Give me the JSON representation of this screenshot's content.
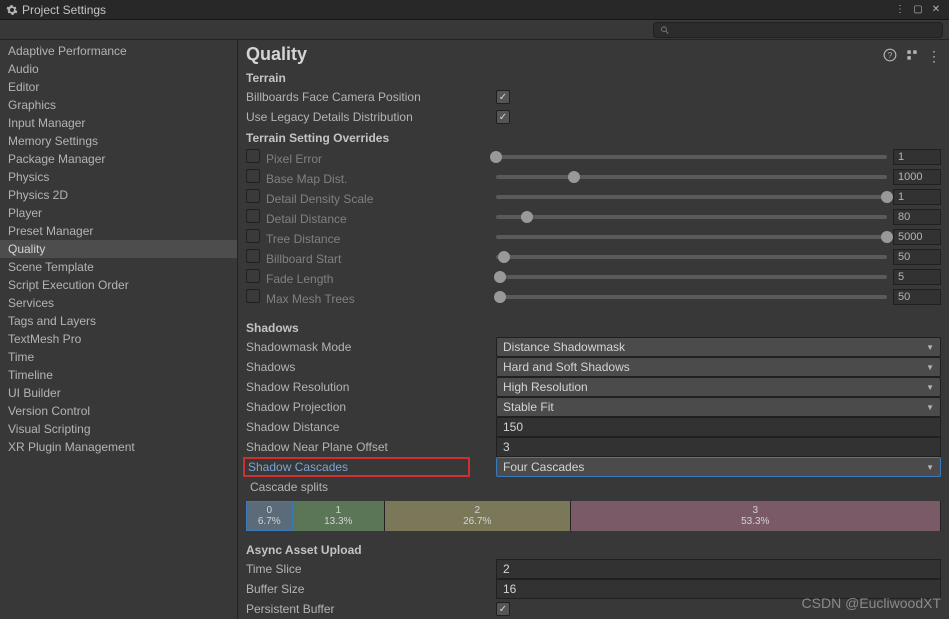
{
  "window": {
    "title": "Project Settings"
  },
  "search": {
    "placeholder": ""
  },
  "sidebar": {
    "items": [
      "Adaptive Performance",
      "Audio",
      "Editor",
      "Graphics",
      "Input Manager",
      "Memory Settings",
      "Package Manager",
      "Physics",
      "Physics 2D",
      "Player",
      "Preset Manager",
      "Quality",
      "Scene Template",
      "Script Execution Order",
      "Services",
      "Tags and Layers",
      "TextMesh Pro",
      "Time",
      "Timeline",
      "UI Builder",
      "Version Control",
      "Visual Scripting",
      "XR Plugin Management"
    ],
    "selected": 11
  },
  "page": {
    "title": "Quality"
  },
  "terrain": {
    "heading": "Terrain",
    "billboards_label": "Billboards Face Camera Position",
    "billboards_checked": true,
    "legacy_label": "Use Legacy Details Distribution",
    "legacy_checked": true
  },
  "overrides": {
    "heading": "Terrain Setting Overrides",
    "rows": [
      {
        "label": "Pixel Error",
        "value": "1",
        "pos": 0
      },
      {
        "label": "Base Map Dist.",
        "value": "1000",
        "pos": 20
      },
      {
        "label": "Detail Density Scale",
        "value": "1",
        "pos": 100
      },
      {
        "label": "Detail Distance",
        "value": "80",
        "pos": 8
      },
      {
        "label": "Tree Distance",
        "value": "5000",
        "pos": 100
      },
      {
        "label": "Billboard Start",
        "value": "50",
        "pos": 2
      },
      {
        "label": "Fade Length",
        "value": "5",
        "pos": 1
      },
      {
        "label": "Max Mesh Trees",
        "value": "50",
        "pos": 1
      }
    ]
  },
  "shadows": {
    "heading": "Shadows",
    "mask_label": "Shadowmask Mode",
    "mask_value": "Distance Shadowmask",
    "shadows_label": "Shadows",
    "shadows_value": "Hard and Soft Shadows",
    "res_label": "Shadow Resolution",
    "res_value": "High Resolution",
    "proj_label": "Shadow Projection",
    "proj_value": "Stable Fit",
    "dist_label": "Shadow Distance",
    "dist_value": "150",
    "near_label": "Shadow Near Plane Offset",
    "near_value": "3",
    "casc_label": "Shadow Cascades",
    "casc_value": "Four Cascades",
    "splits_label": "Cascade splits",
    "cascade": [
      {
        "idx": "0",
        "pct": "6.7%",
        "w": 6.7
      },
      {
        "idx": "1",
        "pct": "13.3%",
        "w": 13.3
      },
      {
        "idx": "2",
        "pct": "26.7%",
        "w": 26.7
      },
      {
        "idx": "3",
        "pct": "53.3%",
        "w": 53.3
      }
    ]
  },
  "async": {
    "heading": "Async Asset Upload",
    "time_label": "Time Slice",
    "time_value": "2",
    "buf_label": "Buffer Size",
    "buf_value": "16",
    "persist_label": "Persistent Buffer",
    "persist_checked": true
  },
  "watermark": "CSDN @EucliwoodXT"
}
